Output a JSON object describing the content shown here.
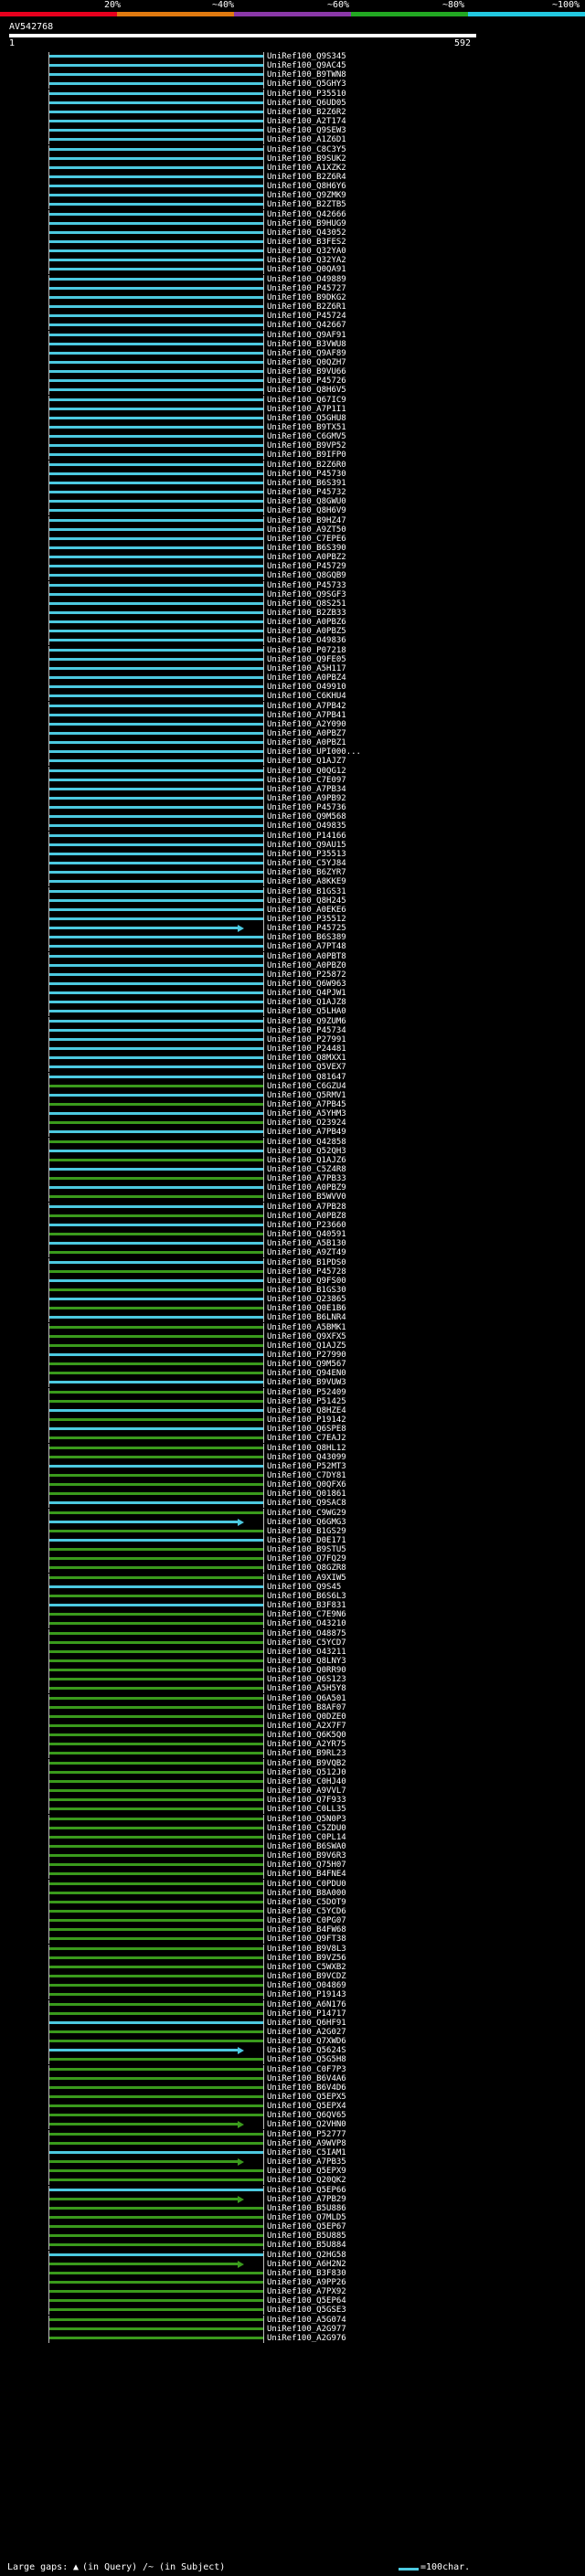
{
  "legend": {
    "percent_labels": [
      "20%",
      "~40%",
      "~60%",
      "~80%",
      "~100%"
    ],
    "colors": [
      "#e8001e",
      "#e07a10",
      "#8a38a8",
      "#22a822",
      "#22c8e0"
    ]
  },
  "query": {
    "title": "AV542768",
    "start": "1",
    "end": "592"
  },
  "hits": [
    {
      "label": "UniRef100_Q9S345",
      "color": "cyan"
    },
    {
      "label": "UniRef100_Q9AC45",
      "color": "cyan"
    },
    {
      "label": "UniRef100_B9TWN8",
      "color": "cyan"
    },
    {
      "label": "UniRef100_Q5GHY3",
      "color": "cyan"
    },
    {
      "label": "UniRef100_P35510",
      "color": "cyan"
    },
    {
      "label": "UniRef100_Q6UD05",
      "color": "cyan"
    },
    {
      "label": "UniRef100_B2Z6R2",
      "color": "cyan"
    },
    {
      "label": "UniRef100_A2T174",
      "color": "cyan"
    },
    {
      "label": "UniRef100_Q9SEW3",
      "color": "cyan"
    },
    {
      "label": "UniRef100_A1Z6D1",
      "color": "cyan"
    },
    {
      "label": "UniRef100_C8C3Y5",
      "color": "cyan"
    },
    {
      "label": "UniRef100_B9SUK2",
      "color": "cyan"
    },
    {
      "label": "UniRef100_A1XZK2",
      "color": "cyan"
    },
    {
      "label": "UniRef100_B2Z6R4",
      "color": "cyan"
    },
    {
      "label": "UniRef100_Q8H6Y6",
      "color": "cyan"
    },
    {
      "label": "UniRef100_Q9ZMK9",
      "color": "cyan"
    },
    {
      "label": "UniRef100_B2ZTB5",
      "color": "cyan"
    },
    {
      "label": "UniRef100_Q42666",
      "color": "cyan"
    },
    {
      "label": "UniRef100_B9HUG9",
      "color": "cyan"
    },
    {
      "label": "UniRef100_Q43052",
      "color": "cyan"
    },
    {
      "label": "UniRef100_B3FES2",
      "color": "cyan"
    },
    {
      "label": "UniRef100_Q32YA0",
      "color": "cyan"
    },
    {
      "label": "UniRef100_Q32YA2",
      "color": "cyan"
    },
    {
      "label": "UniRef100_Q0QA91",
      "color": "cyan"
    },
    {
      "label": "UniRef100_O49889",
      "color": "cyan"
    },
    {
      "label": "UniRef100_P45727",
      "color": "cyan"
    },
    {
      "label": "UniRef100_B9DKG2",
      "color": "cyan"
    },
    {
      "label": "UniRef100_B2Z6R1",
      "color": "cyan"
    },
    {
      "label": "UniRef100_P45724",
      "color": "cyan"
    },
    {
      "label": "UniRef100_Q42667",
      "color": "cyan"
    },
    {
      "label": "UniRef100_Q9AF91",
      "color": "cyan"
    },
    {
      "label": "UniRef100_B3VWU8",
      "color": "cyan"
    },
    {
      "label": "UniRef100_Q9AF89",
      "color": "cyan"
    },
    {
      "label": "UniRef100_Q0QZH7",
      "color": "cyan"
    },
    {
      "label": "UniRef100_B9VU66",
      "color": "cyan"
    },
    {
      "label": "UniRef100_P45726",
      "color": "cyan"
    },
    {
      "label": "UniRef100_Q8H6V5",
      "color": "cyan"
    },
    {
      "label": "UniRef100_Q67IC9",
      "color": "cyan"
    },
    {
      "label": "UniRef100_A7P1I1",
      "color": "cyan"
    },
    {
      "label": "UniRef100_Q5GHU8",
      "color": "cyan"
    },
    {
      "label": "UniRef100_B9TX51",
      "color": "cyan"
    },
    {
      "label": "UniRef100_C6GMV5",
      "color": "cyan"
    },
    {
      "label": "UniRef100_B9VP52",
      "color": "cyan"
    },
    {
      "label": "UniRef100_B9IFP0",
      "color": "cyan"
    },
    {
      "label": "UniRef100_B2Z6R0",
      "color": "cyan"
    },
    {
      "label": "UniRef100_P45730",
      "color": "cyan"
    },
    {
      "label": "UniRef100_B6S391",
      "color": "cyan"
    },
    {
      "label": "UniRef100_P45732",
      "color": "cyan"
    },
    {
      "label": "UniRef100_Q8GWU0",
      "color": "cyan"
    },
    {
      "label": "UniRef100_Q8H6V9",
      "color": "cyan"
    },
    {
      "label": "UniRef100_B9HZ47",
      "color": "cyan"
    },
    {
      "label": "UniRef100_A9ZT50",
      "color": "cyan"
    },
    {
      "label": "UniRef100_C7EPE6",
      "color": "cyan"
    },
    {
      "label": "UniRef100_B6S390",
      "color": "cyan"
    },
    {
      "label": "UniRef100_A0PBZ2",
      "color": "cyan"
    },
    {
      "label": "UniRef100_P45729",
      "color": "cyan"
    },
    {
      "label": "UniRef100_Q8GQB9",
      "color": "cyan"
    },
    {
      "label": "UniRef100_P45733",
      "color": "cyan"
    },
    {
      "label": "UniRef100_Q9SGF3",
      "color": "cyan"
    },
    {
      "label": "UniRef100_Q8S251",
      "color": "cyan"
    },
    {
      "label": "UniRef100_B2ZB33",
      "color": "cyan"
    },
    {
      "label": "UniRef100_A0PBZ6",
      "color": "cyan"
    },
    {
      "label": "UniRef100_A0PBZ5",
      "color": "cyan"
    },
    {
      "label": "UniRef100_O49836",
      "color": "cyan"
    },
    {
      "label": "UniRef100_P07218",
      "color": "cyan"
    },
    {
      "label": "UniRef100_Q9FE05",
      "color": "cyan"
    },
    {
      "label": "UniRef100_A5H117",
      "color": "cyan"
    },
    {
      "label": "UniRef100_A0PBZ4",
      "color": "cyan"
    },
    {
      "label": "UniRef100_O49910",
      "color": "cyan"
    },
    {
      "label": "UniRef100_C6KHU4",
      "color": "cyan"
    },
    {
      "label": "UniRef100_A7PB42",
      "color": "cyan"
    },
    {
      "label": "UniRef100_A7PB41",
      "color": "cyan"
    },
    {
      "label": "UniRef100_A2Y090",
      "color": "cyan"
    },
    {
      "label": "UniRef100_A0PBZ7",
      "color": "cyan"
    },
    {
      "label": "UniRef100_A0PBZ1",
      "color": "cyan"
    },
    {
      "label": "UniRef100_UPI000...",
      "color": "cyan"
    },
    {
      "label": "UniRef100_Q1AJZ7",
      "color": "cyan"
    },
    {
      "label": "UniRef100_Q0QG12",
      "color": "cyan"
    },
    {
      "label": "UniRef100_C7E097",
      "color": "cyan"
    },
    {
      "label": "UniRef100_A7PB34",
      "color": "cyan"
    },
    {
      "label": "UniRef100_A9PB92",
      "color": "cyan"
    },
    {
      "label": "UniRef100_P45736",
      "color": "cyan"
    },
    {
      "label": "UniRef100_Q9M568",
      "color": "cyan"
    },
    {
      "label": "UniRef100_O49835",
      "color": "cyan"
    },
    {
      "label": "UniRef100_P14166",
      "color": "cyan"
    },
    {
      "label": "UniRef100_Q9AU15",
      "color": "cyan"
    },
    {
      "label": "UniRef100_P35513",
      "color": "cyan"
    },
    {
      "label": "UniRef100_C5YJ84",
      "color": "cyan"
    },
    {
      "label": "UniRef100_B6ZYR7",
      "color": "cyan"
    },
    {
      "label": "UniRef100_A8KKE9",
      "color": "cyan"
    },
    {
      "label": "UniRef100_B1GS31",
      "color": "cyan"
    },
    {
      "label": "UniRef100_Q8H245",
      "color": "cyan"
    },
    {
      "label": "UniRef100_A0EKE6",
      "color": "cyan"
    },
    {
      "label": "UniRef100_P35512",
      "color": "cyan"
    },
    {
      "label": "UniRef100_P45725",
      "color": "cyan",
      "arrow": true
    },
    {
      "label": "UniRef100_B6S389",
      "color": "cyan"
    },
    {
      "label": "UniRef100_A7PT48",
      "color": "cyan"
    },
    {
      "label": "UniRef100_A0PBT8",
      "color": "cyan"
    },
    {
      "label": "UniRef100_A0PBZ0",
      "color": "cyan"
    },
    {
      "label": "UniRef100_P25872",
      "color": "cyan"
    },
    {
      "label": "UniRef100_Q6W963",
      "color": "cyan"
    },
    {
      "label": "UniRef100_Q4PJW1",
      "color": "cyan"
    },
    {
      "label": "UniRef100_Q1AJZ8",
      "color": "cyan"
    },
    {
      "label": "UniRef100_Q5LHA0",
      "color": "cyan"
    },
    {
      "label": "UniRef100_Q9ZUM6",
      "color": "cyan"
    },
    {
      "label": "UniRef100_P45734",
      "color": "cyan"
    },
    {
      "label": "UniRef100_P27991",
      "color": "cyan"
    },
    {
      "label": "UniRef100_P24481",
      "color": "cyan"
    },
    {
      "label": "UniRef100_Q8MXX1",
      "color": "cyan"
    },
    {
      "label": "UniRef100_Q5VEX7",
      "color": "cyan"
    },
    {
      "label": "UniRef100_Q81647",
      "color": "cyan"
    },
    {
      "label": "UniRef100_C6GZU4",
      "color": "green"
    },
    {
      "label": "UniRef100_Q5RMV1",
      "color": "cyan"
    },
    {
      "label": "UniRef100_A7PB45",
      "color": "green"
    },
    {
      "label": "UniRef100_A5YHM3",
      "color": "cyan"
    },
    {
      "label": "UniRef100_O23924",
      "color": "green"
    },
    {
      "label": "UniRef100_A7PB49",
      "color": "cyan"
    },
    {
      "label": "UniRef100_Q42858",
      "color": "green"
    },
    {
      "label": "UniRef100_Q52QH3",
      "color": "cyan"
    },
    {
      "label": "UniRef100_Q1AJZ6",
      "color": "green"
    },
    {
      "label": "UniRef100_C5Z4R8",
      "color": "cyan"
    },
    {
      "label": "UniRef100_A7PB33",
      "color": "green"
    },
    {
      "label": "UniRef100_A0PBZ9",
      "color": "cyan"
    },
    {
      "label": "UniRef100_B5WVV0",
      "color": "green"
    },
    {
      "label": "UniRef100_A7PB28",
      "color": "cyan"
    },
    {
      "label": "UniRef100_A0PBZ8",
      "color": "green"
    },
    {
      "label": "UniRef100_P23660",
      "color": "cyan"
    },
    {
      "label": "UniRef100_Q40591",
      "color": "green"
    },
    {
      "label": "UniRef100_A5B130",
      "color": "cyan"
    },
    {
      "label": "UniRef100_A9ZT49",
      "color": "green"
    },
    {
      "label": "UniRef100_B1PDS0",
      "color": "cyan"
    },
    {
      "label": "UniRef100_P45728",
      "color": "green"
    },
    {
      "label": "UniRef100_Q9FS00",
      "color": "cyan"
    },
    {
      "label": "UniRef100_B1GS30",
      "color": "green"
    },
    {
      "label": "UniRef100_Q23865",
      "color": "cyan"
    },
    {
      "label": "UniRef100_Q0E1B6",
      "color": "green"
    },
    {
      "label": "UniRef100_B6LNR4",
      "color": "cyan"
    },
    {
      "label": "UniRef100_A5BMK1",
      "color": "green"
    },
    {
      "label": "UniRef100_Q9XFX5",
      "color": "green"
    },
    {
      "label": "UniRef100_Q1AJZ5",
      "color": "green"
    },
    {
      "label": "UniRef100_P27990",
      "color": "cyan"
    },
    {
      "label": "UniRef100_Q9M567",
      "color": "green"
    },
    {
      "label": "UniRef100_Q94EN0",
      "color": "green"
    },
    {
      "label": "UniRef100_B9VUW3",
      "color": "cyan"
    },
    {
      "label": "UniRef100_P52409",
      "color": "green"
    },
    {
      "label": "UniRef100_P51425",
      "color": "green"
    },
    {
      "label": "UniRef100_Q8HZE4",
      "color": "cyan"
    },
    {
      "label": "UniRef100_P19142",
      "color": "green"
    },
    {
      "label": "UniRef100_Q6SPE8",
      "color": "cyan"
    },
    {
      "label": "UniRef100_C7EAJ2",
      "color": "green"
    },
    {
      "label": "UniRef100_Q8HL12",
      "color": "green"
    },
    {
      "label": "UniRef100_Q43099",
      "color": "green"
    },
    {
      "label": "UniRef100_P52MT3",
      "color": "cyan"
    },
    {
      "label": "UniRef100_C7DY81",
      "color": "green"
    },
    {
      "label": "UniRef100_Q0QFX6",
      "color": "green"
    },
    {
      "label": "UniRef100_Q01861",
      "color": "green"
    },
    {
      "label": "UniRef100_Q9SAC8",
      "color": "cyan"
    },
    {
      "label": "UniRef100_C9WG29",
      "color": "green"
    },
    {
      "label": "UniRef100_Q6GMG3",
      "color": "cyan",
      "arrow": true
    },
    {
      "label": "UniRef100_B1GS29",
      "color": "green"
    },
    {
      "label": "UniRef100_D0E171",
      "color": "cyan"
    },
    {
      "label": "UniRef100_B9STU5",
      "color": "green"
    },
    {
      "label": "UniRef100_Q7FQ29",
      "color": "green"
    },
    {
      "label": "UniRef100_Q8GZR8",
      "color": "green"
    },
    {
      "label": "UniRef100_A9XIW5",
      "color": "green"
    },
    {
      "label": "UniRef100_Q9S45",
      "color": "cyan"
    },
    {
      "label": "UniRef100_B6S6L3",
      "color": "green"
    },
    {
      "label": "UniRef100_B3F831",
      "color": "cyan"
    },
    {
      "label": "UniRef100_C7E9N6",
      "color": "green"
    },
    {
      "label": "UniRef100_O43210",
      "color": "green"
    },
    {
      "label": "UniRef100_O48875",
      "color": "green"
    },
    {
      "label": "UniRef100_C5YCD7",
      "color": "green"
    },
    {
      "label": "UniRef100_O43211",
      "color": "green"
    },
    {
      "label": "UniRef100_Q8LNY3",
      "color": "green"
    },
    {
      "label": "UniRef100_Q0RR90",
      "color": "green"
    },
    {
      "label": "UniRef100_Q6S123",
      "color": "green"
    },
    {
      "label": "UniRef100_A5H5Y8",
      "color": "green"
    },
    {
      "label": "UniRef100_Q6A501",
      "color": "green"
    },
    {
      "label": "UniRef100_B8AF07",
      "color": "green"
    },
    {
      "label": "UniRef100_Q0DZE0",
      "color": "green"
    },
    {
      "label": "UniRef100_A2X7F7",
      "color": "green"
    },
    {
      "label": "UniRef100_Q6K5Q0",
      "color": "green"
    },
    {
      "label": "UniRef100_A2YR75",
      "color": "green"
    },
    {
      "label": "UniRef100_B9RL23",
      "color": "green"
    },
    {
      "label": "UniRef100_B9VQB2",
      "color": "green"
    },
    {
      "label": "UniRef100_Q512J0",
      "color": "green"
    },
    {
      "label": "UniRef100_C0HJ40",
      "color": "green"
    },
    {
      "label": "UniRef100_A9VVL7",
      "color": "green"
    },
    {
      "label": "UniRef100_Q7F933",
      "color": "green"
    },
    {
      "label": "UniRef100_C0LL35",
      "color": "green"
    },
    {
      "label": "UniRef100_Q5N0P3",
      "color": "green"
    },
    {
      "label": "UniRef100_C5ZDU0",
      "color": "green"
    },
    {
      "label": "UniRef100_C0PL14",
      "color": "green"
    },
    {
      "label": "UniRef100_B6SWA0",
      "color": "green"
    },
    {
      "label": "UniRef100_B9V6R3",
      "color": "green"
    },
    {
      "label": "UniRef100_Q75H07",
      "color": "green"
    },
    {
      "label": "UniRef100_B4FNE4",
      "color": "green"
    },
    {
      "label": "UniRef100_C0PDU0",
      "color": "green"
    },
    {
      "label": "UniRef100_B8A000",
      "color": "green"
    },
    {
      "label": "UniRef100_C5DOT9",
      "color": "green"
    },
    {
      "label": "UniRef100_C5YCD6",
      "color": "green"
    },
    {
      "label": "UniRef100_C0PG07",
      "color": "green"
    },
    {
      "label": "UniRef100_B4FW68",
      "color": "green"
    },
    {
      "label": "UniRef100_Q9FT38",
      "color": "green"
    },
    {
      "label": "UniRef100_B9V8L3",
      "color": "green"
    },
    {
      "label": "UniRef100_B9VZ56",
      "color": "green"
    },
    {
      "label": "UniRef100_C5WXB2",
      "color": "green"
    },
    {
      "label": "UniRef100_B9VCDZ",
      "color": "green"
    },
    {
      "label": "UniRef100_O04869",
      "color": "green"
    },
    {
      "label": "UniRef100_P19143",
      "color": "green"
    },
    {
      "label": "UniRef100_A6N176",
      "color": "green"
    },
    {
      "label": "UniRef100_P14717",
      "color": "green"
    },
    {
      "label": "UniRef100_Q6HF91",
      "color": "cyan"
    },
    {
      "label": "UniRef100_A2G027",
      "color": "green"
    },
    {
      "label": "UniRef100_Q7XWD6",
      "color": "green"
    },
    {
      "label": "UniRef100_Q5624S",
      "color": "cyan",
      "arrow": true
    },
    {
      "label": "UniRef100_Q5G5H8",
      "color": "green"
    },
    {
      "label": "UniRef100_C0F7P3",
      "color": "green"
    },
    {
      "label": "UniRef100_B6V4A6",
      "color": "green"
    },
    {
      "label": "UniRef100_B6V4D6",
      "color": "green"
    },
    {
      "label": "UniRef100_Q5EPX5",
      "color": "green"
    },
    {
      "label": "UniRef100_Q5EPX4",
      "color": "green"
    },
    {
      "label": "UniRef100_Q6QV65",
      "color": "green"
    },
    {
      "label": "UniRef100_Q2VHN0",
      "color": "green",
      "arrow": true
    },
    {
      "label": "UniRef100_P52777",
      "color": "green"
    },
    {
      "label": "UniRef100_A9WVP8",
      "color": "green"
    },
    {
      "label": "UniRef100_C5IAM1",
      "color": "cyan"
    },
    {
      "label": "UniRef100_A7PB35",
      "color": "green",
      "arrow": true
    },
    {
      "label": "UniRef100_Q5EPX9",
      "color": "green"
    },
    {
      "label": "UniRef100_Q20QK2",
      "color": "green"
    },
    {
      "label": "UniRef100_Q5EP66",
      "color": "cyan"
    },
    {
      "label": "UniRef100_A7PB29",
      "color": "green",
      "arrow": true
    },
    {
      "label": "UniRef100_B5U886",
      "color": "green"
    },
    {
      "label": "UniRef100_Q7MLD5",
      "color": "green"
    },
    {
      "label": "UniRef100_Q5EP67",
      "color": "green"
    },
    {
      "label": "UniRef100_B5U885",
      "color": "green"
    },
    {
      "label": "UniRef100_B5U884",
      "color": "green"
    },
    {
      "label": "UniRef100_Q2HG58",
      "color": "cyan"
    },
    {
      "label": "UniRef100_A6H2N2",
      "color": "green",
      "arrow": true
    },
    {
      "label": "UniRef100_B3F830",
      "color": "green"
    },
    {
      "label": "UniRef100_A9PP26",
      "color": "green"
    },
    {
      "label": "UniRef100_A7PX92",
      "color": "green"
    },
    {
      "label": "UniRef100_Q5EP64",
      "color": "green"
    },
    {
      "label": "UniRef100_Q5GSE3",
      "color": "green"
    },
    {
      "label": "UniRef100_A5G074",
      "color": "green"
    },
    {
      "label": "UniRef100_A2G977",
      "color": "green"
    },
    {
      "label": "UniRef100_A2G976",
      "color": "green"
    }
  ],
  "footer": {
    "large_gaps_label": "Large gaps:",
    "in_query_label": "(in Query)",
    "in_subject_label": "/~ (in Subject)",
    "scale_label": "=100char."
  }
}
